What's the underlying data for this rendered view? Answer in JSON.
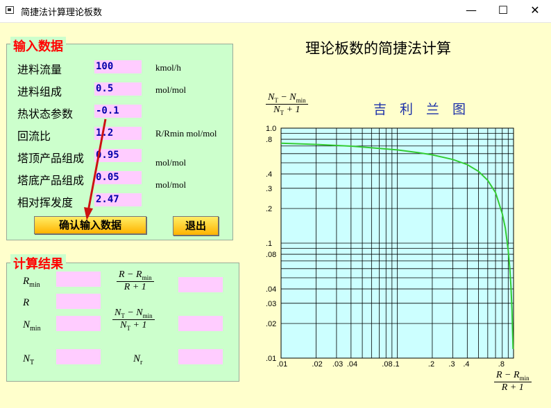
{
  "window": {
    "title": "简捷法计算理论板数",
    "minimize_glyph": "—",
    "maximize_glyph": "☐",
    "close_glyph": "✕"
  },
  "input_panel": {
    "legend": "输入数据",
    "fields": [
      {
        "label": "进料流量",
        "value": "100",
        "unit": "kmol/h"
      },
      {
        "label": "进料组成",
        "value": "0.5",
        "unit": "mol/mol"
      },
      {
        "label": "热状态参数",
        "value": "-0.1",
        "unit": ""
      },
      {
        "label": "回流比",
        "value": "1.2",
        "unit": "R/Rmin mol/mol"
      },
      {
        "label": "塔顶产品组成",
        "value": "0.95",
        "unit": "mol/mol"
      },
      {
        "label": "塔底产品组成",
        "value": "0.05",
        "unit": "mol/mol"
      },
      {
        "label": "相对挥发度",
        "value": "2.47",
        "unit": ""
      }
    ],
    "confirm_button": "确认输入数据",
    "exit_button": "退出"
  },
  "results_panel": {
    "legend": "计算结果",
    "symbols": {
      "rmin": "R",
      "rmin_sub": "min",
      "r": "R",
      "nmin": "N",
      "nmin_sub": "min",
      "nt": "N",
      "nt_sub": "T",
      "nr": "N",
      "nr_sub": "r"
    },
    "frac_r": {
      "num_a": "R − R",
      "num_sub": "min",
      "den": "R + 1"
    },
    "frac_n": {
      "num_a": "N",
      "num_a_sub": "T",
      "num_b": " − N",
      "num_b_sub": "min",
      "den_a": "N",
      "den_a_sub": "T",
      "den_b": " + 1"
    }
  },
  "chart": {
    "main_title": "理论板数的简捷法计算",
    "name": "吉利兰图",
    "y_label": {
      "num_a": "N",
      "num_a_sub": "T",
      "num_b": " − N",
      "num_b_sub": "min",
      "den_a": "N",
      "den_a_sub": "T",
      "den_b": " + 1"
    },
    "x_label": {
      "num_a": "R − R",
      "num_sub": "min",
      "den": "R + 1"
    },
    "line_color": "#33CC33",
    "plot_bg": "#CCFFFF"
  },
  "chart_data": {
    "type": "line",
    "title": "吉利兰图",
    "x_scale": "log",
    "y_scale": "log",
    "xlim": [
      0.01,
      1.0
    ],
    "ylim": [
      0.01,
      1.0
    ],
    "x_ticks": [
      {
        "v": 0.01,
        "t": ".01"
      },
      {
        "v": 0.02,
        "t": ".02"
      },
      {
        "v": 0.03,
        "t": ".03"
      },
      {
        "v": 0.04,
        "t": ".04"
      },
      {
        "v": 0.08,
        "t": ".08"
      },
      {
        "v": 0.1,
        "t": ".1"
      },
      {
        "v": 0.2,
        "t": ".2"
      },
      {
        "v": 0.3,
        "t": ".3"
      },
      {
        "v": 0.4,
        "t": ".4"
      },
      {
        "v": 0.8,
        "t": ".8"
      }
    ],
    "y_ticks": [
      {
        "v": 1.0,
        "t": "1.0"
      },
      {
        "v": 0.8,
        "t": ".8"
      },
      {
        "v": 0.4,
        "t": ".4"
      },
      {
        "v": 0.3,
        "t": ".3"
      },
      {
        "v": 0.2,
        "t": ".2"
      },
      {
        "v": 0.1,
        "t": ".1"
      },
      {
        "v": 0.08,
        "t": ".08"
      },
      {
        "v": 0.04,
        "t": ".04"
      },
      {
        "v": 0.03,
        "t": ".03"
      },
      {
        "v": 0.02,
        "t": ".02"
      },
      {
        "v": 0.01,
        "t": ".01"
      }
    ],
    "grid_values": [
      0.01,
      0.02,
      0.03,
      0.04,
      0.05,
      0.06,
      0.07,
      0.08,
      0.09,
      0.1,
      0.2,
      0.3,
      0.4,
      0.5,
      0.6,
      0.7,
      0.8,
      0.9,
      1.0
    ],
    "grid": true,
    "series": [
      {
        "x": [
          0.01,
          0.02,
          0.04,
          0.07,
          0.1,
          0.15,
          0.2,
          0.3,
          0.4,
          0.5,
          0.6,
          0.7,
          0.8,
          0.85,
          0.9,
          0.93,
          0.95,
          0.97,
          0.98,
          0.99
        ],
        "y": [
          0.74,
          0.722,
          0.697,
          0.667,
          0.647,
          0.614,
          0.586,
          0.534,
          0.482,
          0.421,
          0.352,
          0.275,
          0.18,
          0.135,
          0.087,
          0.06,
          0.042,
          0.026,
          0.018,
          0.012
        ]
      }
    ]
  }
}
